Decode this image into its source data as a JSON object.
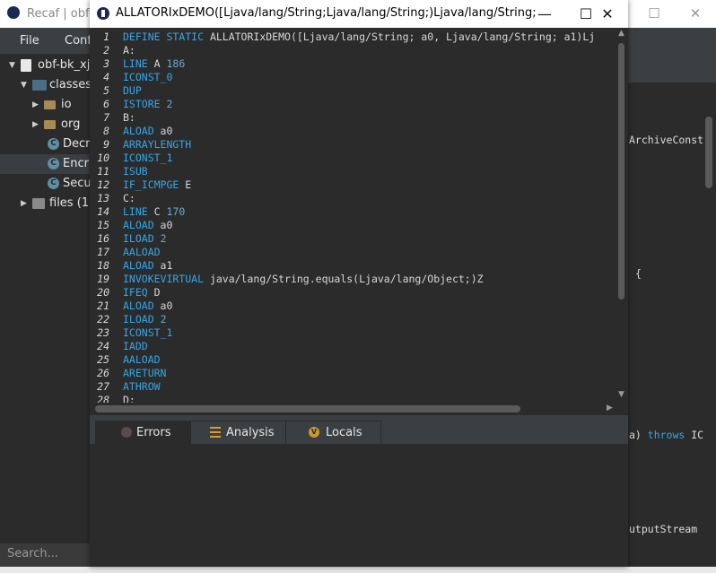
{
  "main_window": {
    "title": "Recaf | obf-",
    "menu": [
      "File",
      "Conf"
    ],
    "tree": [
      {
        "label": "obf-bk_xj",
        "indent": 0,
        "arrow": "down",
        "icon": "jar"
      },
      {
        "label": "classes",
        "indent": 1,
        "arrow": "down",
        "icon": "folder"
      },
      {
        "label": "io",
        "indent": 2,
        "arrow": "right",
        "icon": "package"
      },
      {
        "label": "org",
        "indent": 2,
        "arrow": "right",
        "icon": "package"
      },
      {
        "label": "Decr",
        "indent": 2,
        "arrow": "",
        "icon": "class"
      },
      {
        "label": "Encr",
        "indent": 2,
        "arrow": "",
        "icon": "class"
      },
      {
        "label": "Secu",
        "indent": 2,
        "arrow": "",
        "icon": "class"
      },
      {
        "label": "files (13",
        "indent": 1,
        "arrow": "right",
        "icon": "files"
      }
    ],
    "search_placeholder": "Search...",
    "right_code": {
      "line1": "ArchiveConst",
      "line2": "{",
      "line3_a": "a) ",
      "line3_kw": "throws",
      "line3_b": " IC",
      "line4": "utputStream"
    }
  },
  "dialog": {
    "title": "ALLATORIxDEMO([Ljava/lang/String;Ljava/lang/String;)Ljava/lang/String;",
    "controls": {
      "minimize": "—",
      "maximize": "☐",
      "close": "✕"
    },
    "code_lines": [
      {
        "n": "1",
        "parts": [
          [
            "kw",
            "DEFINE STATIC"
          ],
          [
            "t",
            " ALLATORIxDEMO([Ljava/lang/String; a0, Ljava/lang/String; a1)Lj"
          ]
        ]
      },
      {
        "n": "2",
        "parts": [
          [
            "t",
            "A:"
          ]
        ]
      },
      {
        "n": "3",
        "parts": [
          [
            "kw",
            "LINE"
          ],
          [
            "t",
            " A "
          ],
          [
            "num",
            "186"
          ]
        ]
      },
      {
        "n": "4",
        "parts": [
          [
            "kw",
            "ICONST_0"
          ]
        ]
      },
      {
        "n": "5",
        "parts": [
          [
            "kw",
            "DUP"
          ]
        ]
      },
      {
        "n": "6",
        "parts": [
          [
            "kw",
            "ISTORE"
          ],
          [
            "t",
            " "
          ],
          [
            "num",
            "2"
          ]
        ]
      },
      {
        "n": "7",
        "parts": [
          [
            "t",
            "B:"
          ]
        ]
      },
      {
        "n": "8",
        "parts": [
          [
            "kw",
            "ALOAD"
          ],
          [
            "t",
            " a0"
          ]
        ]
      },
      {
        "n": "9",
        "parts": [
          [
            "kw",
            "ARRAYLENGTH"
          ]
        ]
      },
      {
        "n": "10",
        "parts": [
          [
            "kw",
            "ICONST_1"
          ]
        ]
      },
      {
        "n": "11",
        "parts": [
          [
            "kw",
            "ISUB"
          ]
        ]
      },
      {
        "n": "12",
        "parts": [
          [
            "kw",
            "IF_ICMPGE"
          ],
          [
            "t",
            " E"
          ]
        ]
      },
      {
        "n": "13",
        "parts": [
          [
            "t",
            "C:"
          ]
        ]
      },
      {
        "n": "14",
        "parts": [
          [
            "kw",
            "LINE"
          ],
          [
            "t",
            " C "
          ],
          [
            "num",
            "170"
          ]
        ]
      },
      {
        "n": "15",
        "parts": [
          [
            "kw",
            "ALOAD"
          ],
          [
            "t",
            " a0"
          ]
        ]
      },
      {
        "n": "16",
        "parts": [
          [
            "kw",
            "ILOAD"
          ],
          [
            "t",
            " "
          ],
          [
            "num",
            "2"
          ]
        ]
      },
      {
        "n": "17",
        "parts": [
          [
            "kw",
            "AALOAD"
          ]
        ]
      },
      {
        "n": "18",
        "parts": [
          [
            "kw",
            "ALOAD"
          ],
          [
            "t",
            " a1"
          ]
        ]
      },
      {
        "n": "19",
        "parts": [
          [
            "kw",
            "INVOKEVIRTUAL"
          ],
          [
            "t",
            " java/lang/String.equals(Ljava/lang/Object;)Z"
          ]
        ]
      },
      {
        "n": "20",
        "parts": [
          [
            "kw",
            "IFEQ"
          ],
          [
            "t",
            " D"
          ]
        ]
      },
      {
        "n": "21",
        "parts": [
          [
            "kw",
            "ALOAD"
          ],
          [
            "t",
            " a0"
          ]
        ]
      },
      {
        "n": "22",
        "parts": [
          [
            "kw",
            "ILOAD"
          ],
          [
            "t",
            " "
          ],
          [
            "num",
            "2"
          ]
        ]
      },
      {
        "n": "23",
        "parts": [
          [
            "kw",
            "ICONST_1"
          ]
        ]
      },
      {
        "n": "24",
        "parts": [
          [
            "kw",
            "IADD"
          ]
        ]
      },
      {
        "n": "25",
        "parts": [
          [
            "kw",
            "AALOAD"
          ]
        ]
      },
      {
        "n": "26",
        "parts": [
          [
            "kw",
            "ARETURN"
          ]
        ]
      },
      {
        "n": "27",
        "parts": [
          [
            "kw",
            "ATHROW"
          ]
        ]
      },
      {
        "n": "28",
        "parts": [
          [
            "t",
            "D:"
          ]
        ]
      }
    ],
    "tabs": [
      {
        "label": "Errors",
        "icon": "error-icon",
        "active": true
      },
      {
        "label": "Analysis",
        "icon": "analysis-icon",
        "active": false
      },
      {
        "label": "Locals",
        "icon": "locals-icon",
        "active": false
      }
    ]
  },
  "colors": {
    "keyword": "#35a6e8",
    "background": "#2b2b2b",
    "tab_bar": "#3c3f41"
  }
}
